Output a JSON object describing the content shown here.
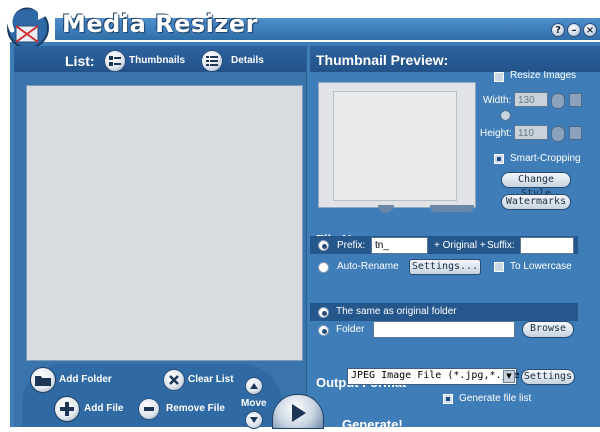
{
  "window": {
    "title": "Media Resizer",
    "controls": {
      "help": "?",
      "minimize": "–",
      "close": "×"
    }
  },
  "list": {
    "label": "List:",
    "view_thumbnails": "Thumbnails",
    "view_details": "Details",
    "actions": {
      "add_folder": "Add Folder",
      "add_file": "Add File",
      "clear_list": "Clear List",
      "remove_file": "Remove File",
      "move": "Move"
    }
  },
  "preview": {
    "heading": "Thumbnail Preview:",
    "resize_images": "Resize Images",
    "width_label": "Width:",
    "width_value": "130",
    "height_label": "Height:",
    "height_value": "110",
    "smart_cropping": "Smart-Cropping",
    "change_style": "Change Style",
    "watermarks": "Watermarks"
  },
  "file_name": {
    "heading": "File Name",
    "prefix_label": "Prefix:",
    "prefix_value": "tn_",
    "original_label": "+ Original +",
    "suffix_label": "Suffix:",
    "suffix_value": "",
    "auto_rename": "Auto-Rename",
    "settings_button": "Settings...",
    "to_lowercase": "To Lowercase"
  },
  "output": {
    "same_as_original": "The same as original folder",
    "folder_label": "Folder",
    "folder_value": "",
    "browse_button": "Browse",
    "format_heading": "Output Format",
    "format_value": "JPEG Image File (*.jpg,*.jpe",
    "format_settings_button": "Settings",
    "generate_file_list": "Generate file list",
    "generate_button": "Generate!"
  },
  "colors": {
    "panel_blue": "#3a74ad",
    "header_blue": "#235289",
    "accent_dark": "#1b4f86"
  }
}
